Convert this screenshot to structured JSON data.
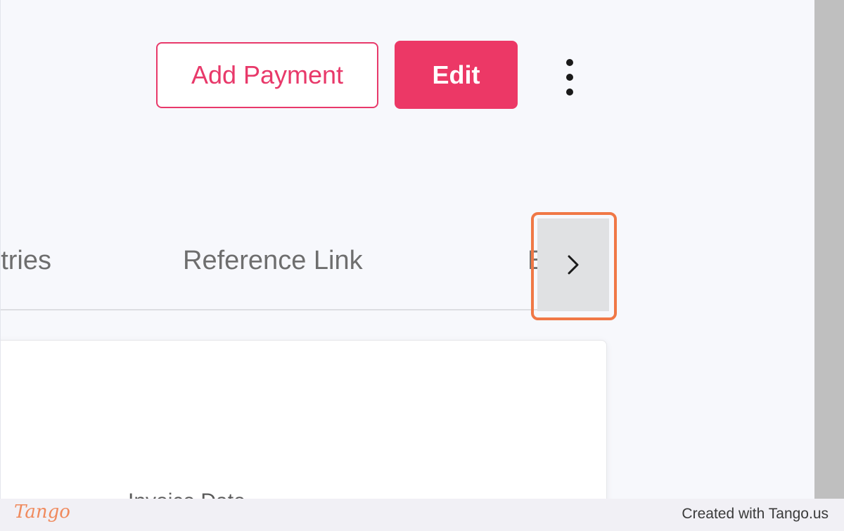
{
  "header": {
    "add_payment_label": "Add Payment",
    "edit_label": "Edit"
  },
  "tabs": [
    {
      "label": "Entries",
      "visible_text": "tries"
    },
    {
      "label": "Reference Link"
    },
    {
      "label": "E"
    }
  ],
  "card": {
    "invoice_date_label": "Invoice Date"
  },
  "footer": {
    "logo": "Tango",
    "created_with": "Created with Tango.us"
  },
  "colors": {
    "accent": "#ec3866",
    "highlight": "#f07846",
    "background": "#f7f8fc"
  },
  "icons": {
    "more": "more-vertical-icon",
    "next": "chevron-right-icon"
  }
}
